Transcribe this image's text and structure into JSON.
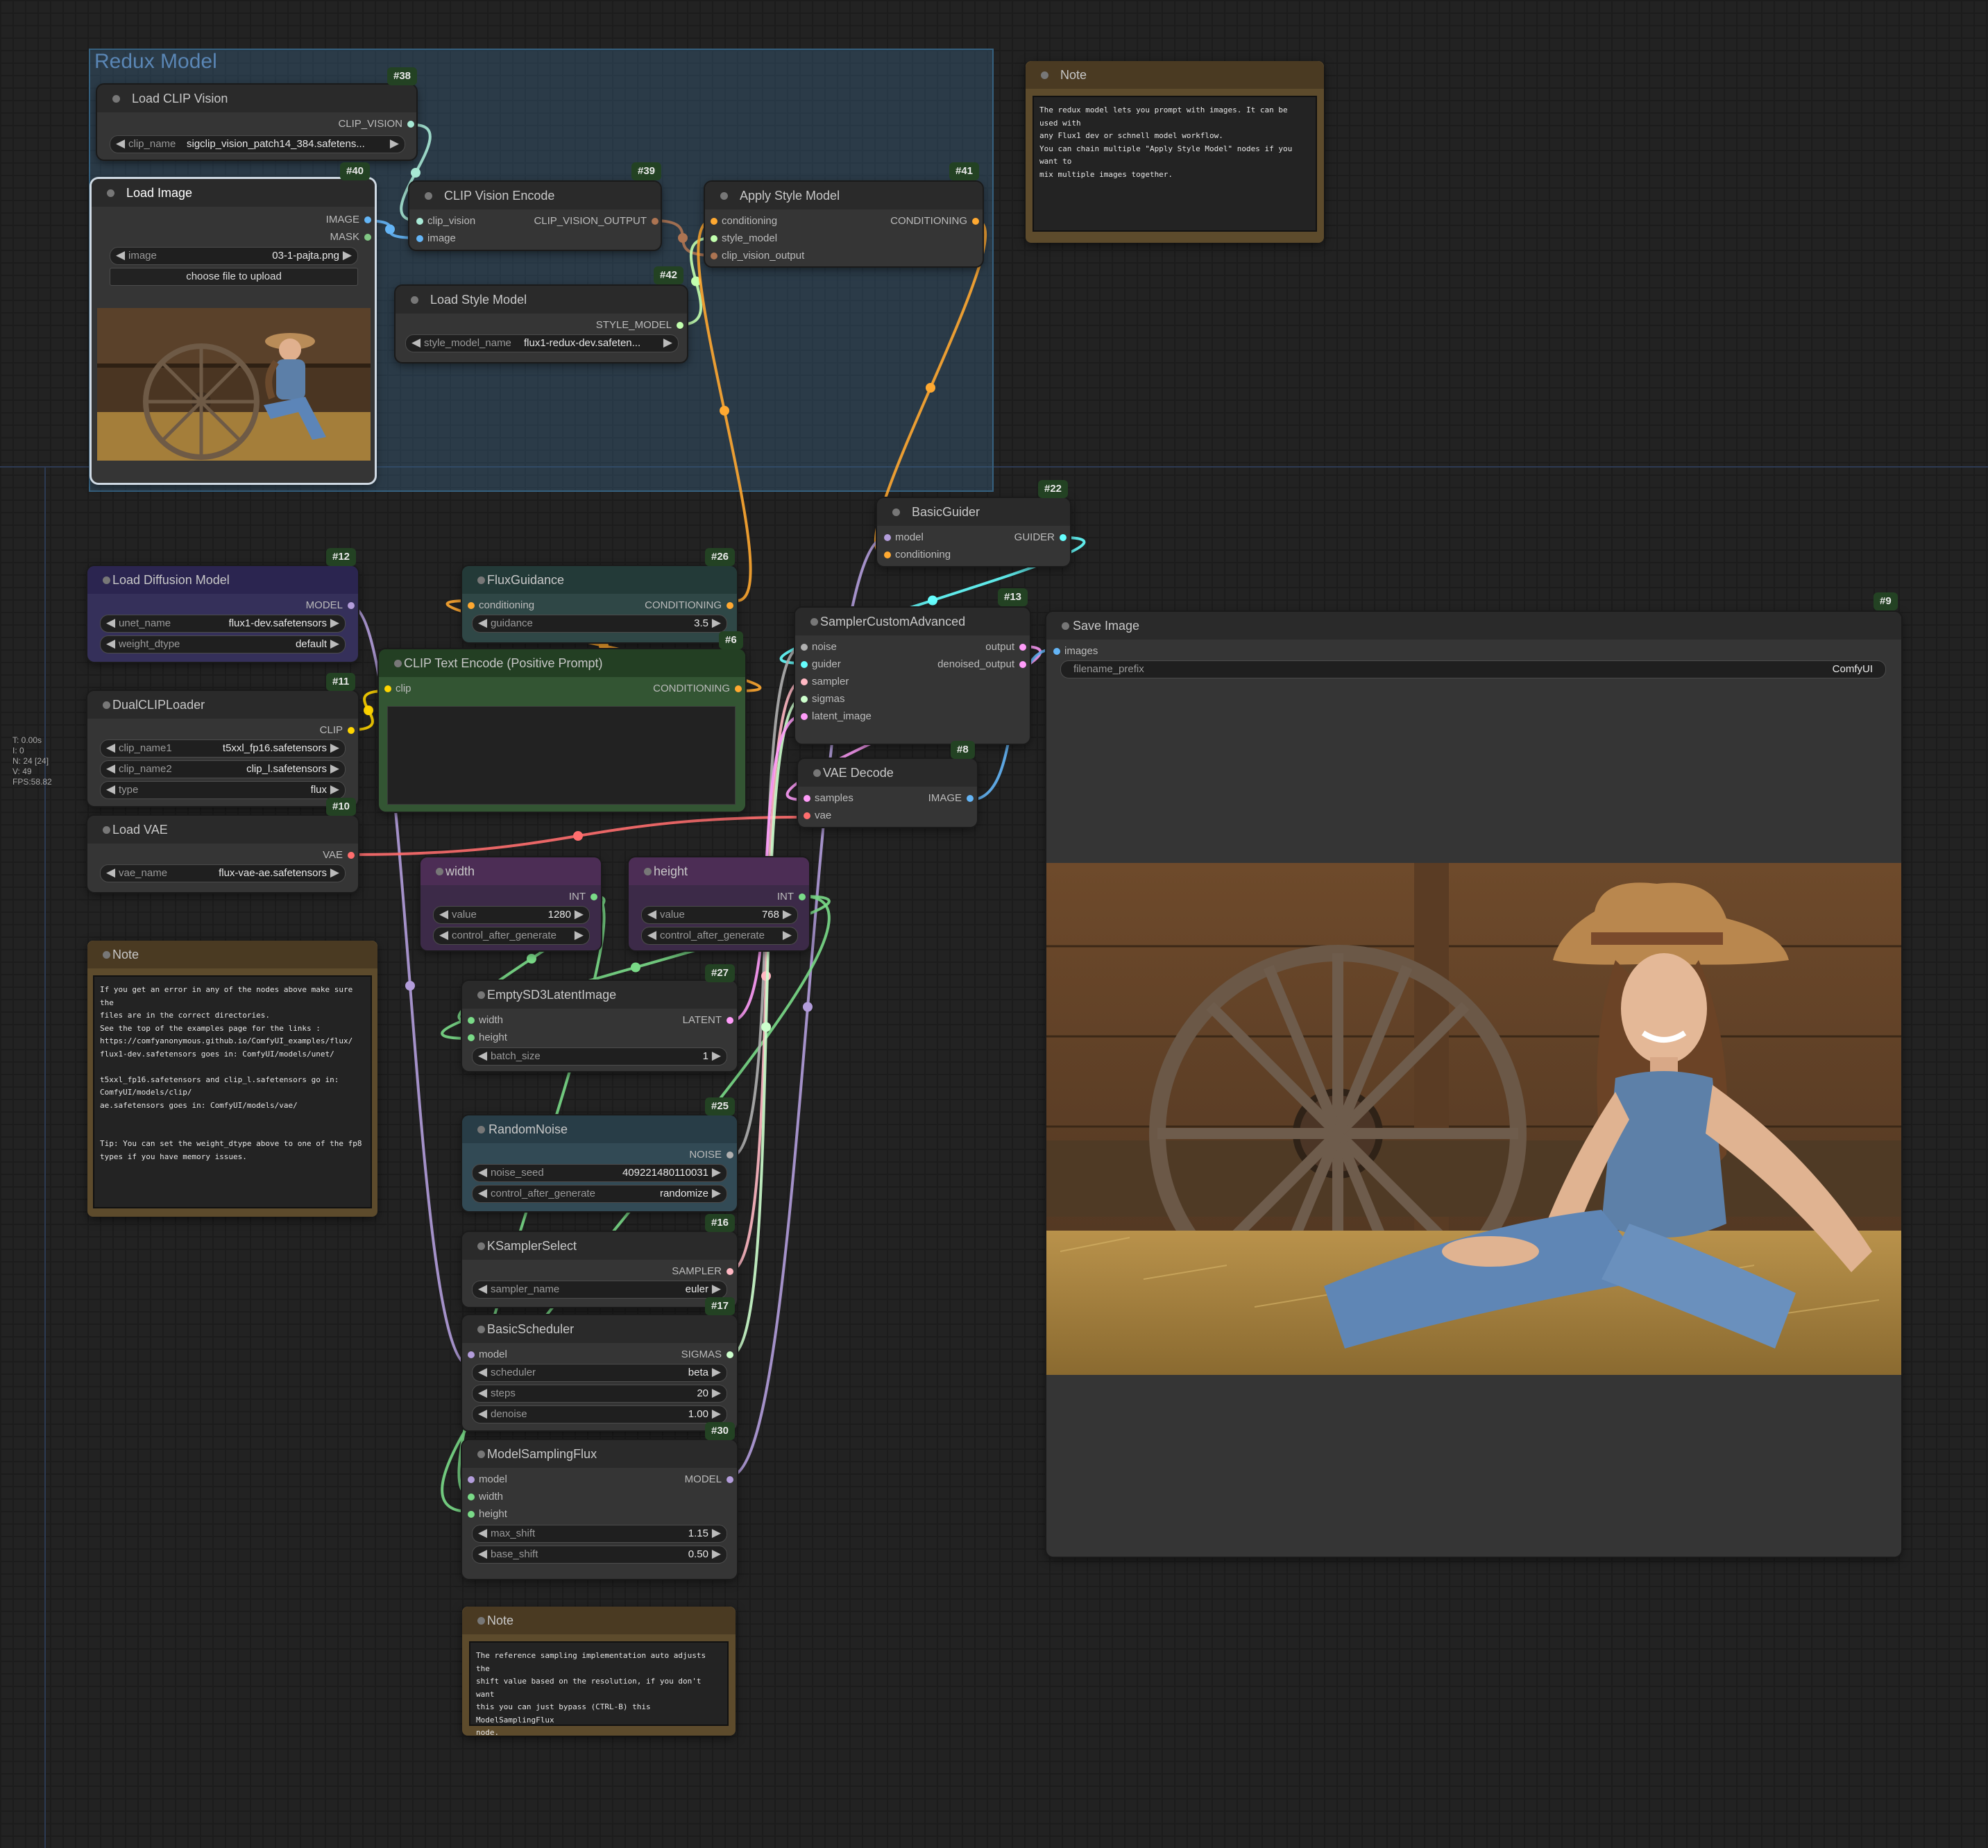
{
  "colors": {
    "clip_vision": "#a9ead6",
    "image": "#64b5f6",
    "mask": "#81c784",
    "conditioning": "#ffa931",
    "style_model": "#c2ffae",
    "clip_vision_output": "#ad7452",
    "model": "#b39ddb",
    "clip": "#ffd500",
    "vae": "#ff6e6e",
    "int": "#7adb88",
    "latent": "#ff9cf9",
    "noise": "#b0b0b0",
    "guider": "#66ffff",
    "sampler": "#ffb8c3",
    "sigmas": "#cdffcd",
    "float": "#aaee88"
  },
  "stats": [
    "T: 0.00s",
    "I: 0",
    "N: 24 [24]",
    "V: 49",
    "FPS:58.82"
  ],
  "group": {
    "title": "Redux Model"
  },
  "nodes": {
    "load_clip_vision": {
      "id": "#38",
      "title": "Load CLIP Vision",
      "out1": "CLIP_VISION",
      "w1_name": "clip_name",
      "w1_value": "sigclip_vision_patch14_384.safetens..."
    },
    "load_image": {
      "id": "#40",
      "title": "Load Image",
      "out1": "IMAGE",
      "out2": "MASK",
      "w1_name": "image",
      "w1_value": "03-1-pajta.png",
      "upload_label": "choose file to upload"
    },
    "clip_vision_encode": {
      "id": "#39",
      "title": "CLIP Vision Encode",
      "in1": "clip_vision",
      "in2": "image",
      "out1": "CLIP_VISION_OUTPUT"
    },
    "apply_style_model": {
      "id": "#41",
      "title": "Apply Style Model",
      "in1": "conditioning",
      "in2": "style_model",
      "in3": "clip_vision_output",
      "out1": "CONDITIONING"
    },
    "load_style_model": {
      "id": "#42",
      "title": "Load Style Model",
      "out1": "STYLE_MODEL",
      "w1_name": "style_model_name",
      "w1_value": "flux1-redux-dev.safeten..."
    },
    "basic_guider": {
      "id": "#22",
      "title": "BasicGuider",
      "in1": "model",
      "in2": "conditioning",
      "out1": "GUIDER"
    },
    "load_diffusion_model": {
      "id": "#12",
      "title": "Load Diffusion Model",
      "out1": "MODEL",
      "w1_name": "unet_name",
      "w1_value": "flux1-dev.safetensors",
      "w2_name": "weight_dtype",
      "w2_value": "default"
    },
    "flux_guidance": {
      "id": "#26",
      "title": "FluxGuidance",
      "in1": "conditioning",
      "out1": "CONDITIONING",
      "w1_name": "guidance",
      "w1_value": "3.5"
    },
    "clip_text_encode": {
      "id": "#6",
      "title": "CLIP Text Encode (Positive Prompt)",
      "in1": "clip",
      "out1": "CONDITIONING",
      "text": ""
    },
    "sampler_custom_advanced": {
      "id": "#13",
      "title": "SamplerCustomAdvanced",
      "in1": "noise",
      "in2": "guider",
      "in3": "sampler",
      "in4": "sigmas",
      "in5": "latent_image",
      "out1": "output",
      "out2": "denoised_output"
    },
    "save_image": {
      "id": "#9",
      "title": "Save Image",
      "in1": "images",
      "w1_name": "filename_prefix",
      "w1_value": "ComfyUI"
    },
    "dual_clip_loader": {
      "id": "#11",
      "title": "DualCLIPLoader",
      "out1": "CLIP",
      "w1_name": "clip_name1",
      "w1_value": "t5xxl_fp16.safetensors",
      "w2_name": "clip_name2",
      "w2_value": "clip_l.safetensors",
      "w3_name": "type",
      "w3_value": "flux"
    },
    "load_vae": {
      "id": "#10",
      "title": "Load VAE",
      "out1": "VAE",
      "w1_name": "vae_name",
      "w1_value": "flux-vae-ae.safetensors"
    },
    "vae_decode": {
      "id": "#8",
      "title": "VAE Decode",
      "in1": "samples",
      "in2": "vae",
      "out1": "IMAGE"
    },
    "width": {
      "title": "width",
      "out1": "INT",
      "w1_name": "value",
      "w1_value": "1280",
      "w2_name": "control_after_generate",
      "w2_value": ""
    },
    "height": {
      "title": "height",
      "out1": "INT",
      "w1_name": "value",
      "w1_value": "768",
      "w2_name": "control_after_generate",
      "w2_value": ""
    },
    "empty_latent": {
      "id": "#27",
      "title": "EmptySD3LatentImage",
      "in1": "width",
      "in2": "height",
      "out1": "LATENT",
      "w1_name": "batch_size",
      "w1_value": "1"
    },
    "random_noise": {
      "id": "#25",
      "title": "RandomNoise",
      "out1": "NOISE",
      "w1_name": "noise_seed",
      "w1_value": "409221480110031",
      "w2_name": "control_after_generate",
      "w2_value": "randomize"
    },
    "ksampler_select": {
      "id": "#16",
      "title": "KSamplerSelect",
      "out1": "SAMPLER",
      "w1_name": "sampler_name",
      "w1_value": "euler"
    },
    "basic_scheduler": {
      "id": "#17",
      "title": "BasicScheduler",
      "in1": "model",
      "out1": "SIGMAS",
      "w1_name": "scheduler",
      "w1_value": "beta",
      "w2_name": "steps",
      "w2_value": "20",
      "w3_name": "denoise",
      "w3_value": "1.00"
    },
    "model_sampling_flux": {
      "id": "#30",
      "title": "ModelSamplingFlux",
      "in1": "model",
      "in2": "width",
      "in3": "height",
      "out1": "MODEL",
      "w1_name": "max_shift",
      "w1_value": "1.15",
      "w2_name": "base_shift",
      "w2_value": "0.50"
    }
  },
  "notes": {
    "top": {
      "title": "Note",
      "text": "The redux model lets you prompt with images. It can be used with\nany Flux1 dev or schnell model workflow.\nYou can chain multiple \"Apply Style Model\" nodes if you want to\nmix multiple images together."
    },
    "left": {
      "title": "Note",
      "text": "If you get an error in any of the nodes above make sure the\nfiles are in the correct directories.\nSee the top of the examples page for the links :\nhttps://comfyanonymous.github.io/ComfyUI_examples/flux/\nflux1-dev.safetensors goes in: ComfyUI/models/unet/\n\nt5xxl_fp16.safetensors and clip_l.safetensors go in:\nComfyUI/models/clip/\nae.safetensors goes in: ComfyUI/models/vae/\n\n\nTip: You can set the weight_dtype above to one of the fp8\ntypes if you have memory issues."
    },
    "bottom": {
      "title": "Note",
      "text": "The reference sampling implementation auto adjusts the\nshift value based on the resolution, if you don't want\nthis you can just bypass (CTRL-B) this ModelSamplingFlux\nnode."
    }
  }
}
